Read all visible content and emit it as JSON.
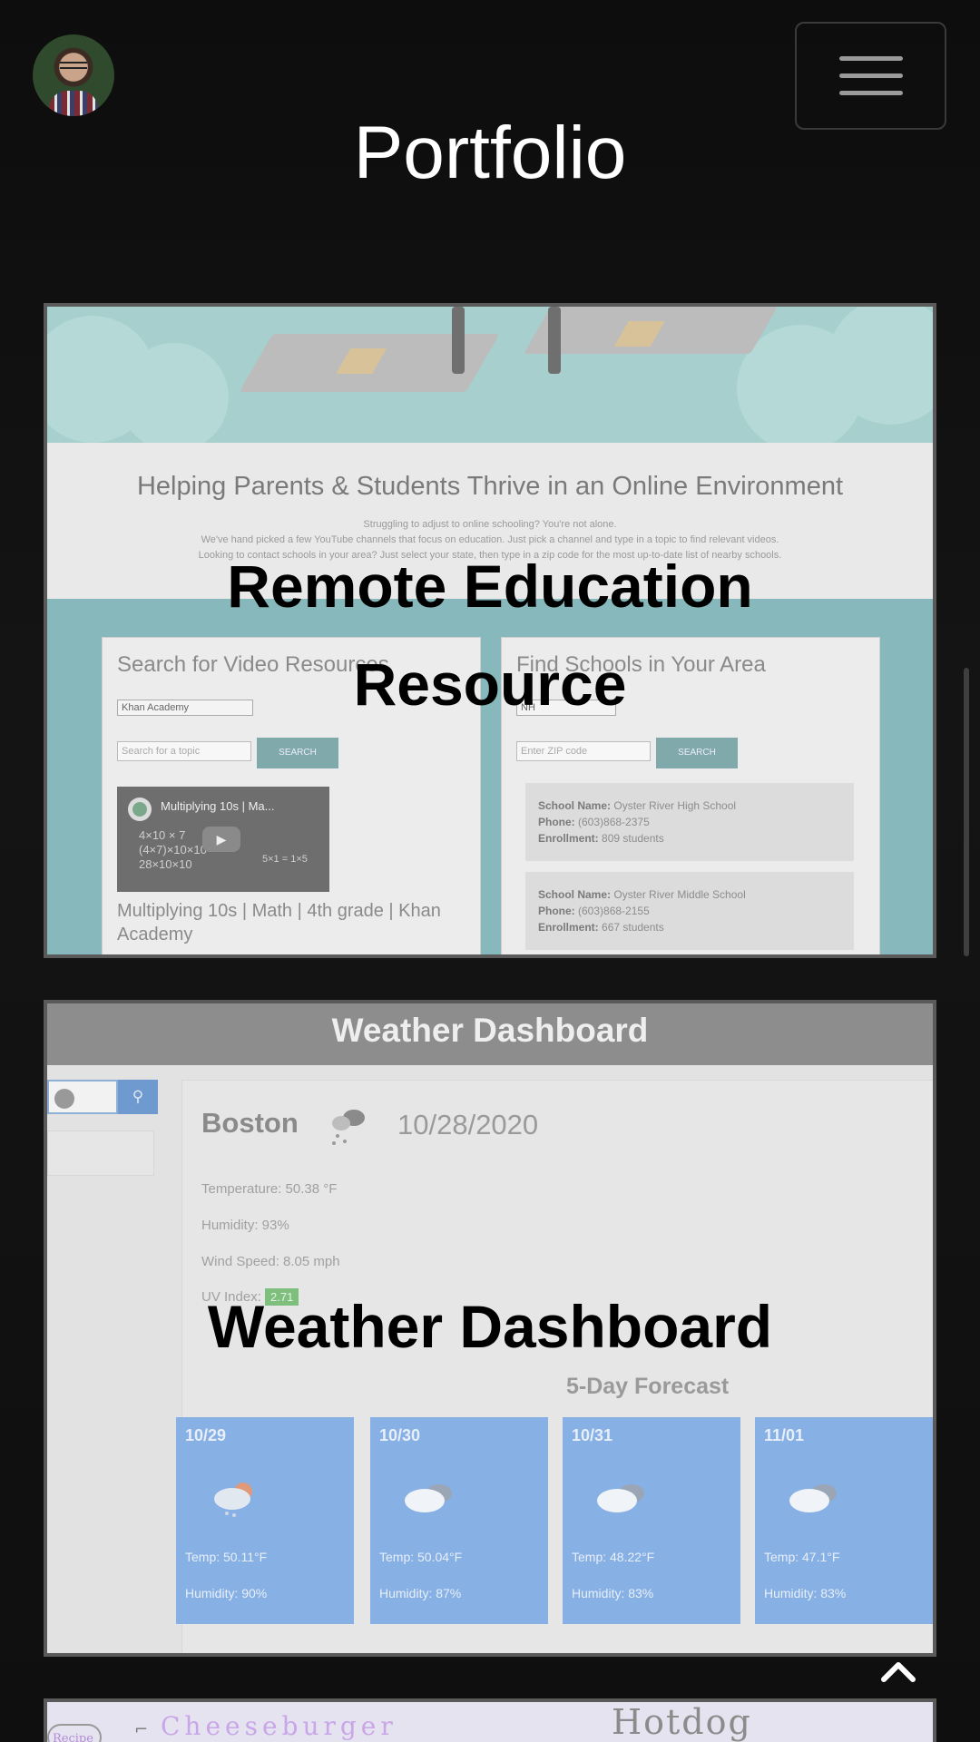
{
  "header": {
    "title": "Portfolio",
    "avatar_icon": "avatar-photo",
    "menu_icon": "hamburger-menu-icon"
  },
  "projects": [
    {
      "title_line1": "Remote Education",
      "title_line2": "Resource",
      "screenshot": {
        "heading": "Helping Parents & Students Thrive in an Online Environment",
        "sub1": "Struggling to adjust to online schooling? You're not alone.",
        "sub2": "We've hand picked a few YouTube channels that focus on education. Just pick a channel and type in a topic to find relevant videos.",
        "sub3": "Looking to contact schools in your area? Just select your state, then type in a zip code for the most up-to-date list of nearby schools.",
        "video_panel": {
          "title": "Search for Video Resources",
          "select_value": "Khan Academy",
          "input_placeholder": "Search for a topic",
          "button": "SEARCH",
          "video_title": "Multiplying 10s | Ma...",
          "video_math": "4×10 × 7\n(4×7)×10×10\n28×10×10",
          "video_math_side": "5×1 = 1×5",
          "caption": "Multiplying 10s | Math | 4th grade | Khan Academy"
        },
        "school_panel": {
          "title": "Find Schools in Your Area",
          "select_value": "NH",
          "input_placeholder": "Enter ZIP code",
          "button": "SEARCH",
          "schools": [
            {
              "name_label": "School Name:",
              "name": "Oyster River High School",
              "phone_label": "Phone:",
              "phone": "(603)868-2375",
              "enroll_label": "Enrollment:",
              "enroll": "809 students"
            },
            {
              "name_label": "School Name:",
              "name": "Oyster River Middle School",
              "phone_label": "Phone:",
              "phone": "(603)868-2155",
              "enroll_label": "Enrollment:",
              "enroll": "667 students"
            }
          ]
        }
      }
    },
    {
      "title": "Weather Dashboard",
      "screenshot": {
        "header": "Weather Dashboard",
        "city": "Boston",
        "date": "10/28/2020",
        "temperature": "Temperature: 50.38 °F",
        "humidity": "Humidity: 93%",
        "wind": "Wind Speed: 8.05 mph",
        "uv_label": "UV Index:",
        "uv_value": "2.71",
        "forecast_title": "5-Day Forecast",
        "days": [
          {
            "date": "10/29",
            "temp": "Temp: 50.11°F",
            "humidity": "Humidity: 90%"
          },
          {
            "date": "10/30",
            "temp": "Temp: 50.04°F",
            "humidity": "Humidity: 87%"
          },
          {
            "date": "10/31",
            "temp": "Temp: 48.22°F",
            "humidity": "Humidity: 83%"
          },
          {
            "date": "11/01",
            "temp": "Temp: 47.1°F",
            "humidity": "Humidity: 83%"
          }
        ]
      }
    },
    {
      "screenshot": {
        "pill": "Recipe",
        "left_word": "Cheeseburger",
        "right_word": "Hotdog"
      }
    }
  ],
  "colors": {
    "background": "#0e0e0e",
    "teal": "#87b9bc",
    "forecast_blue": "#87b0e4",
    "uv_green": "#7ebf7e"
  }
}
